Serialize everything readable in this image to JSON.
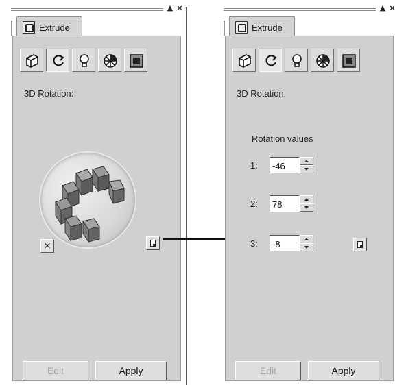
{
  "panels": [
    {
      "tab_label": "Extrude",
      "section_label": "3D Rotation:",
      "mode": "sphere",
      "reset_symbol": "×",
      "edit_label": "Edit",
      "apply_label": "Apply"
    },
    {
      "tab_label": "Extrude",
      "section_label": "3D Rotation:",
      "mode": "values",
      "rotation_values_title": "Rotation values",
      "rows": [
        {
          "label": "1:",
          "value": "-46"
        },
        {
          "label": "2:",
          "value": "78"
        },
        {
          "label": "3:",
          "value": "-8"
        }
      ],
      "edit_label": "Edit",
      "apply_label": "Apply"
    }
  ],
  "toolbar_icons": [
    "extrude-icon",
    "rotation-icon",
    "lighting-icon",
    "color-icon",
    "bevel-icon"
  ],
  "titlebar_icons": [
    "collapse-icon",
    "close-icon"
  ],
  "titlebar_symbols": {
    "collapse": "▲",
    "close": "×"
  },
  "colors": {
    "panel_bg": "#d0d0d0",
    "disabled_text": "#a6a6a6",
    "arrow": "#111111"
  }
}
